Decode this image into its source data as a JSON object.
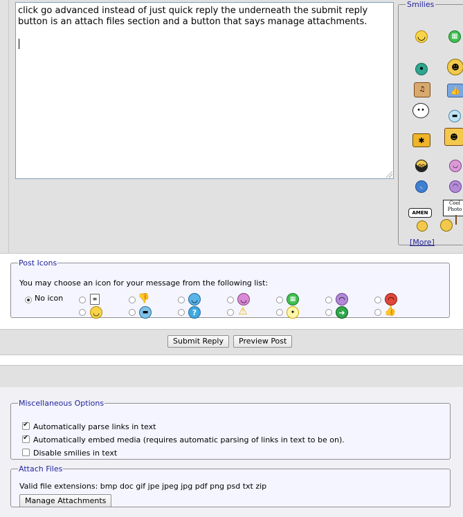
{
  "editor": {
    "text": "click go advanced instead of just quick reply the underneath the submit reply button is an attach files section and a button that says manage attachments."
  },
  "smilies": {
    "legend": "Smilies",
    "more_label": "[More]",
    "amen_text": "AMEN",
    "cool_photo_text": "Cool Photo",
    "items": [
      "smile",
      "big-grin",
      "teal-face",
      "dancing-guy",
      "drummer",
      "thumbs-up",
      "speech-bubble",
      "sunglasses",
      "bee",
      "sign-holder",
      "ninja",
      "purple-face",
      "blue-face",
      "purple-frown",
      "amen",
      "cool-photo"
    ]
  },
  "post_icons": {
    "legend": "Post Icons",
    "intro": "You may choose an icon for your message from the following list:",
    "no_icon_label": "No icon",
    "icons": [
      "document",
      "thumbs-down",
      "smile-blue",
      "purple-grin",
      "green-grin",
      "purple-frown",
      "red-angry",
      "smile",
      "sunglasses",
      "question",
      "warning",
      "lightbulb",
      "arrow-right",
      "thumbs-up"
    ]
  },
  "actions": {
    "submit_label": "Submit Reply",
    "preview_label": "Preview Post"
  },
  "misc": {
    "legend": "Miscellaneous Options",
    "options": [
      {
        "label": "Automatically parse links in text",
        "checked": true
      },
      {
        "label": "Automatically embed media (requires automatic parsing of links in text to be on).",
        "checked": true
      },
      {
        "label": "Disable smilies in text",
        "checked": false
      }
    ]
  },
  "attach": {
    "legend": "Attach Files",
    "extensions": "Valid file extensions: bmp doc gif jpe jpeg jpg pdf png psd txt zip",
    "manage_label": "Manage Attachments"
  },
  "colors": {
    "legend": "#22229c",
    "panel": "#e1e1e2",
    "editor_border": "#7f9db9"
  }
}
